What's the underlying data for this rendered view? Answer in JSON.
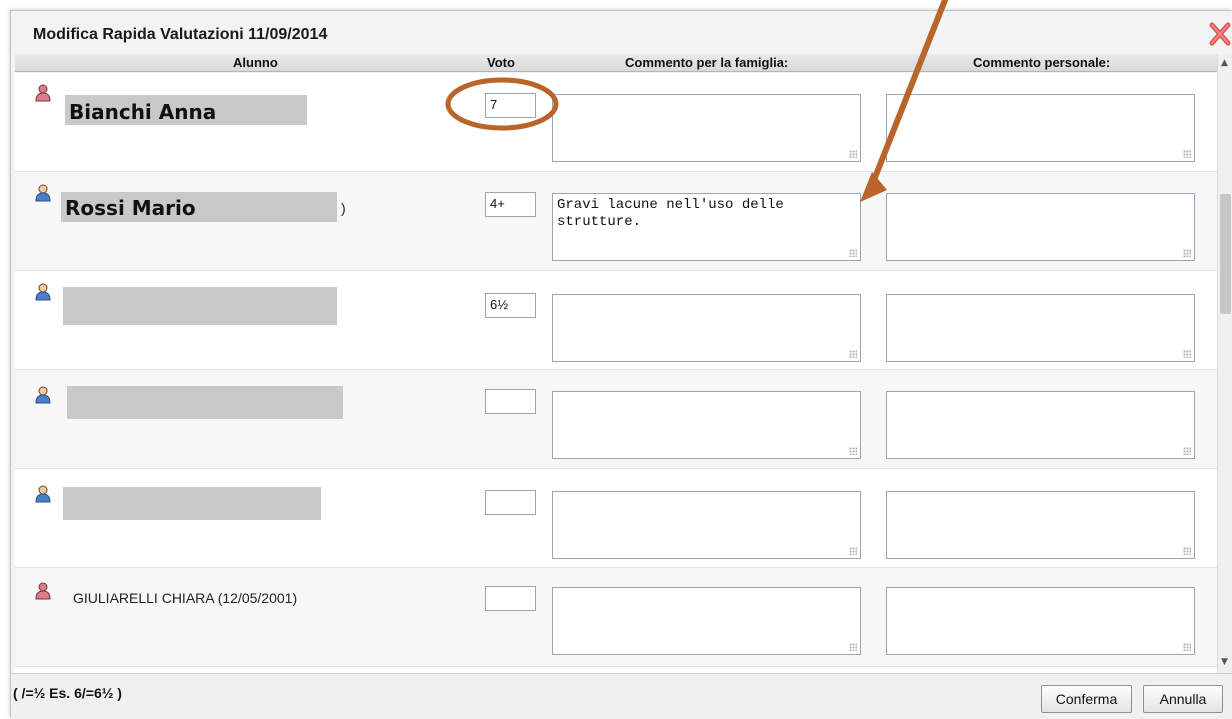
{
  "dialog": {
    "title": "Modifica Rapida Valutazioni 11/09/2014"
  },
  "columns": {
    "alunno": "Alunno",
    "voto": "Voto",
    "commento_famiglia": "Commento per la famiglia:",
    "commento_personale": "Commento personale:"
  },
  "rows": [
    {
      "name": "Bianchi Anna",
      "redacted": true,
      "gender": "female",
      "voto": "7",
      "commento_famiglia": "",
      "commento_personale": ""
    },
    {
      "name": "Rossi Mario",
      "suffix": ")",
      "redacted": true,
      "gender": "male",
      "voto": "4+",
      "commento_famiglia": "Gravi lacune nell'uso delle strutture.",
      "commento_personale": ""
    },
    {
      "name": "",
      "redacted": true,
      "gender": "male",
      "voto": "6½",
      "commento_famiglia": "",
      "commento_personale": ""
    },
    {
      "name": "",
      "redacted": true,
      "gender": "male",
      "voto": "",
      "commento_famiglia": "",
      "commento_personale": ""
    },
    {
      "name": "",
      "redacted": true,
      "gender": "male",
      "voto": "",
      "commento_famiglia": "",
      "commento_personale": ""
    },
    {
      "name": "GIULIARELLI CHIARA (12/05/2001)",
      "redacted": false,
      "gender": "female",
      "voto": "",
      "commento_famiglia": "",
      "commento_personale": ""
    }
  ],
  "footer": {
    "hint": "( /=½ Es. 6/=6½ )",
    "confirm_label": "Conferma",
    "cancel_label": "Annulla"
  },
  "colors": {
    "annotation": "#b8642a",
    "close": "#d9534f",
    "female_avatar": "#e07a8a",
    "male_avatar": "#4a7fc9"
  },
  "icons": {
    "close": "close-icon",
    "female_user": "female-user-icon",
    "male_user": "male-user-icon"
  }
}
